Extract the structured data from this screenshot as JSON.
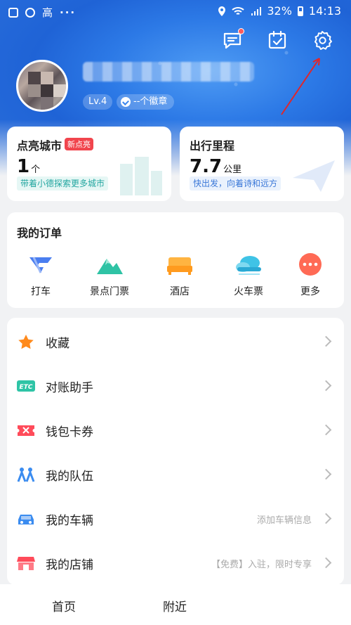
{
  "status_bar": {
    "app_abbrev": "高",
    "dots": "···",
    "battery": "32%",
    "time": "14:13",
    "signal": "4G"
  },
  "profile": {
    "level": "Lv.4",
    "medals": "--个徽章"
  },
  "stats": [
    {
      "title": "点亮城市",
      "tag": "新点亮",
      "value": "1",
      "unit": "个",
      "tip": "带着小德探索更多城市"
    },
    {
      "title": "出行里程",
      "value": "7.7",
      "unit": "公里",
      "tip": "快出发，向着诗和远方"
    }
  ],
  "orders": {
    "title": "我的订单",
    "items": [
      {
        "label": "打车",
        "icon": "taxi-icon"
      },
      {
        "label": "景点门票",
        "icon": "mountain-icon"
      },
      {
        "label": "酒店",
        "icon": "bed-icon"
      },
      {
        "label": "火车票",
        "icon": "cloud-train-icon"
      },
      {
        "label": "更多",
        "icon": "more-icon"
      }
    ]
  },
  "menu": [
    {
      "label": "收藏",
      "icon": "star-icon",
      "hint": ""
    },
    {
      "label": "对账助手",
      "icon": "etc-icon",
      "hint": ""
    },
    {
      "label": "钱包卡券",
      "icon": "ticket-icon",
      "hint": ""
    },
    {
      "label": "我的队伍",
      "icon": "team-icon",
      "hint": ""
    },
    {
      "label": "我的车辆",
      "icon": "car-icon",
      "hint": "添加车辆信息"
    },
    {
      "label": "我的店铺",
      "icon": "store-icon",
      "hint": "【免费】入驻，限时专享"
    }
  ],
  "tabbar": {
    "home": "首页",
    "nearby": "附近"
  },
  "colors": {
    "header_blue": "#2c79e6",
    "tag_red": "#f1454d",
    "teal": "#23a6a0",
    "blue_tip": "#3b78d8"
  }
}
